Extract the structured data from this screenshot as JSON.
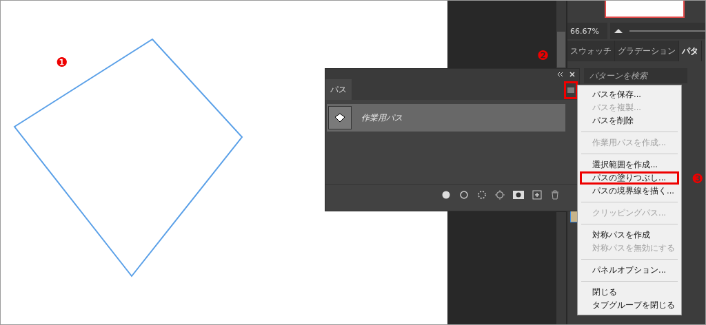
{
  "callouts": [
    "❶",
    "❷",
    "❸"
  ],
  "navigator": {
    "zoom": "66.67%",
    "level": 1
  },
  "swatch_tabs": [
    {
      "label": "スウォッチ",
      "selected": false
    },
    {
      "label": "グラデーション",
      "selected": false
    },
    {
      "label": "パタ",
      "selected": true
    }
  ],
  "pattern_search": {
    "placeholder": "パターンを検索"
  },
  "paths_panel": {
    "tab": {
      "label": "パス",
      "selected": true
    },
    "menu_button_highlighted": true,
    "rows": [
      {
        "name": "作業用パス",
        "selected": true
      }
    ]
  },
  "panel_menu": [
    {
      "kind": "item",
      "label": "パスを保存...",
      "disabled": false,
      "highlighted": false
    },
    {
      "kind": "item",
      "label": "パスを複製...",
      "disabled": true,
      "highlighted": false
    },
    {
      "kind": "item",
      "label": "パスを削除",
      "disabled": false,
      "highlighted": false
    },
    {
      "kind": "separator"
    },
    {
      "kind": "item",
      "label": "作業用パスを作成...",
      "disabled": true,
      "highlighted": false
    },
    {
      "kind": "separator"
    },
    {
      "kind": "item",
      "label": "選択範囲を作成...",
      "disabled": false,
      "highlighted": false
    },
    {
      "kind": "item",
      "label": "パスの塗りつぶし...",
      "disabled": false,
      "highlighted": true
    },
    {
      "kind": "item",
      "label": "パスの境界線を描く...",
      "disabled": false,
      "highlighted": false
    },
    {
      "kind": "separator"
    },
    {
      "kind": "item",
      "label": "クリッピングパス...",
      "disabled": true,
      "highlighted": false
    },
    {
      "kind": "separator"
    },
    {
      "kind": "item",
      "label": "対称パスを作成",
      "disabled": false,
      "highlighted": false
    },
    {
      "kind": "item",
      "label": "対称パスを無効にする",
      "disabled": true,
      "highlighted": false
    },
    {
      "kind": "separator"
    },
    {
      "kind": "item",
      "label": "パネルオプション...",
      "disabled": false,
      "highlighted": false
    },
    {
      "kind": "separator"
    },
    {
      "kind": "item",
      "label": "閉じる",
      "disabled": false,
      "highlighted": false
    },
    {
      "kind": "item",
      "label": "タブグループを閉じる",
      "disabled": false,
      "highlighted": false
    }
  ]
}
